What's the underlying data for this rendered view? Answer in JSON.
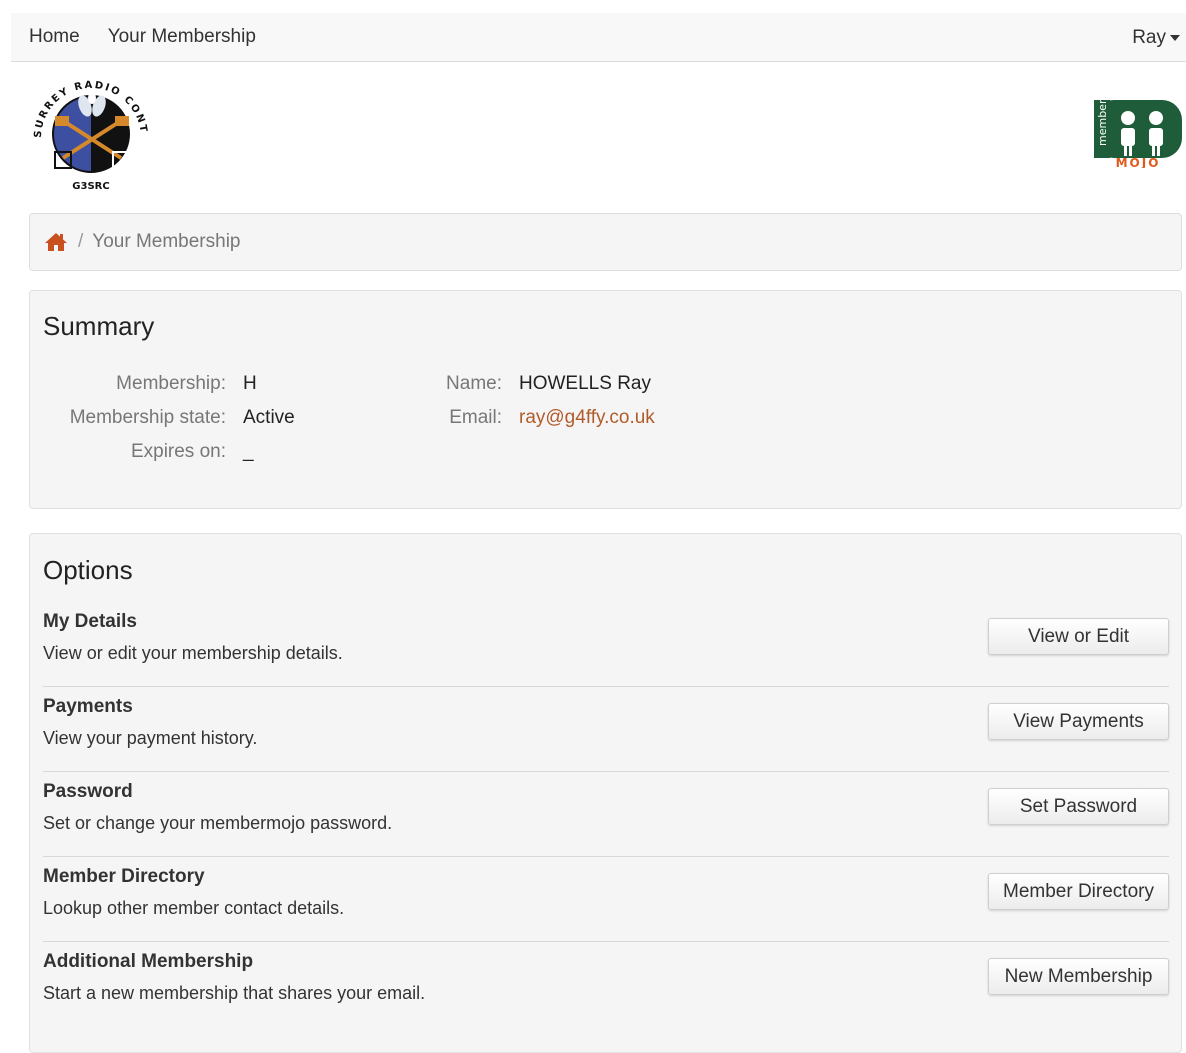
{
  "nav": {
    "items": [
      {
        "label": "Home"
      },
      {
        "label": "Your Membership"
      }
    ],
    "user": "Ray"
  },
  "logos": {
    "club": {
      "top_text": "SURREY RADIO CONTACT CLUB",
      "bottom_text": "G3SRC"
    },
    "mm": {
      "side_text": "member",
      "bottom_text": "MOJO"
    }
  },
  "breadcrumb": {
    "separator": "/",
    "current": "Your Membership",
    "home_icon": "home-icon"
  },
  "summary": {
    "title": "Summary",
    "left": [
      {
        "label": "Membership:",
        "value": "H"
      },
      {
        "label": "Membership state:",
        "value": "Active"
      },
      {
        "label": "Expires on:",
        "value": "_"
      }
    ],
    "right": [
      {
        "label": "Name:",
        "value": "HOWELLS Ray"
      },
      {
        "label": "Email:",
        "value": "ray@g4ffy.co.uk"
      }
    ]
  },
  "options": {
    "title": "Options",
    "items": [
      {
        "title": "My Details",
        "desc": "View or edit your membership details.",
        "button": "View or Edit"
      },
      {
        "title": "Payments",
        "desc": "View your payment history.",
        "button": "View Payments"
      },
      {
        "title": "Password",
        "desc": "Set or change your membermojo password.",
        "button": "Set Password"
      },
      {
        "title": "Member Directory",
        "desc": "Lookup other member contact details.",
        "button": "Member Directory"
      },
      {
        "title": "Additional Membership",
        "desc": "Start a new membership that shares your email.",
        "button": "New Membership"
      }
    ]
  },
  "colors": {
    "link": "#b25b2a",
    "home_icon": "#c8511f",
    "mm_green": "#1e5c3a",
    "mm_orange": "#e05a1c",
    "club_blue": "#3d4fa0",
    "club_gold": "#d6892b"
  }
}
